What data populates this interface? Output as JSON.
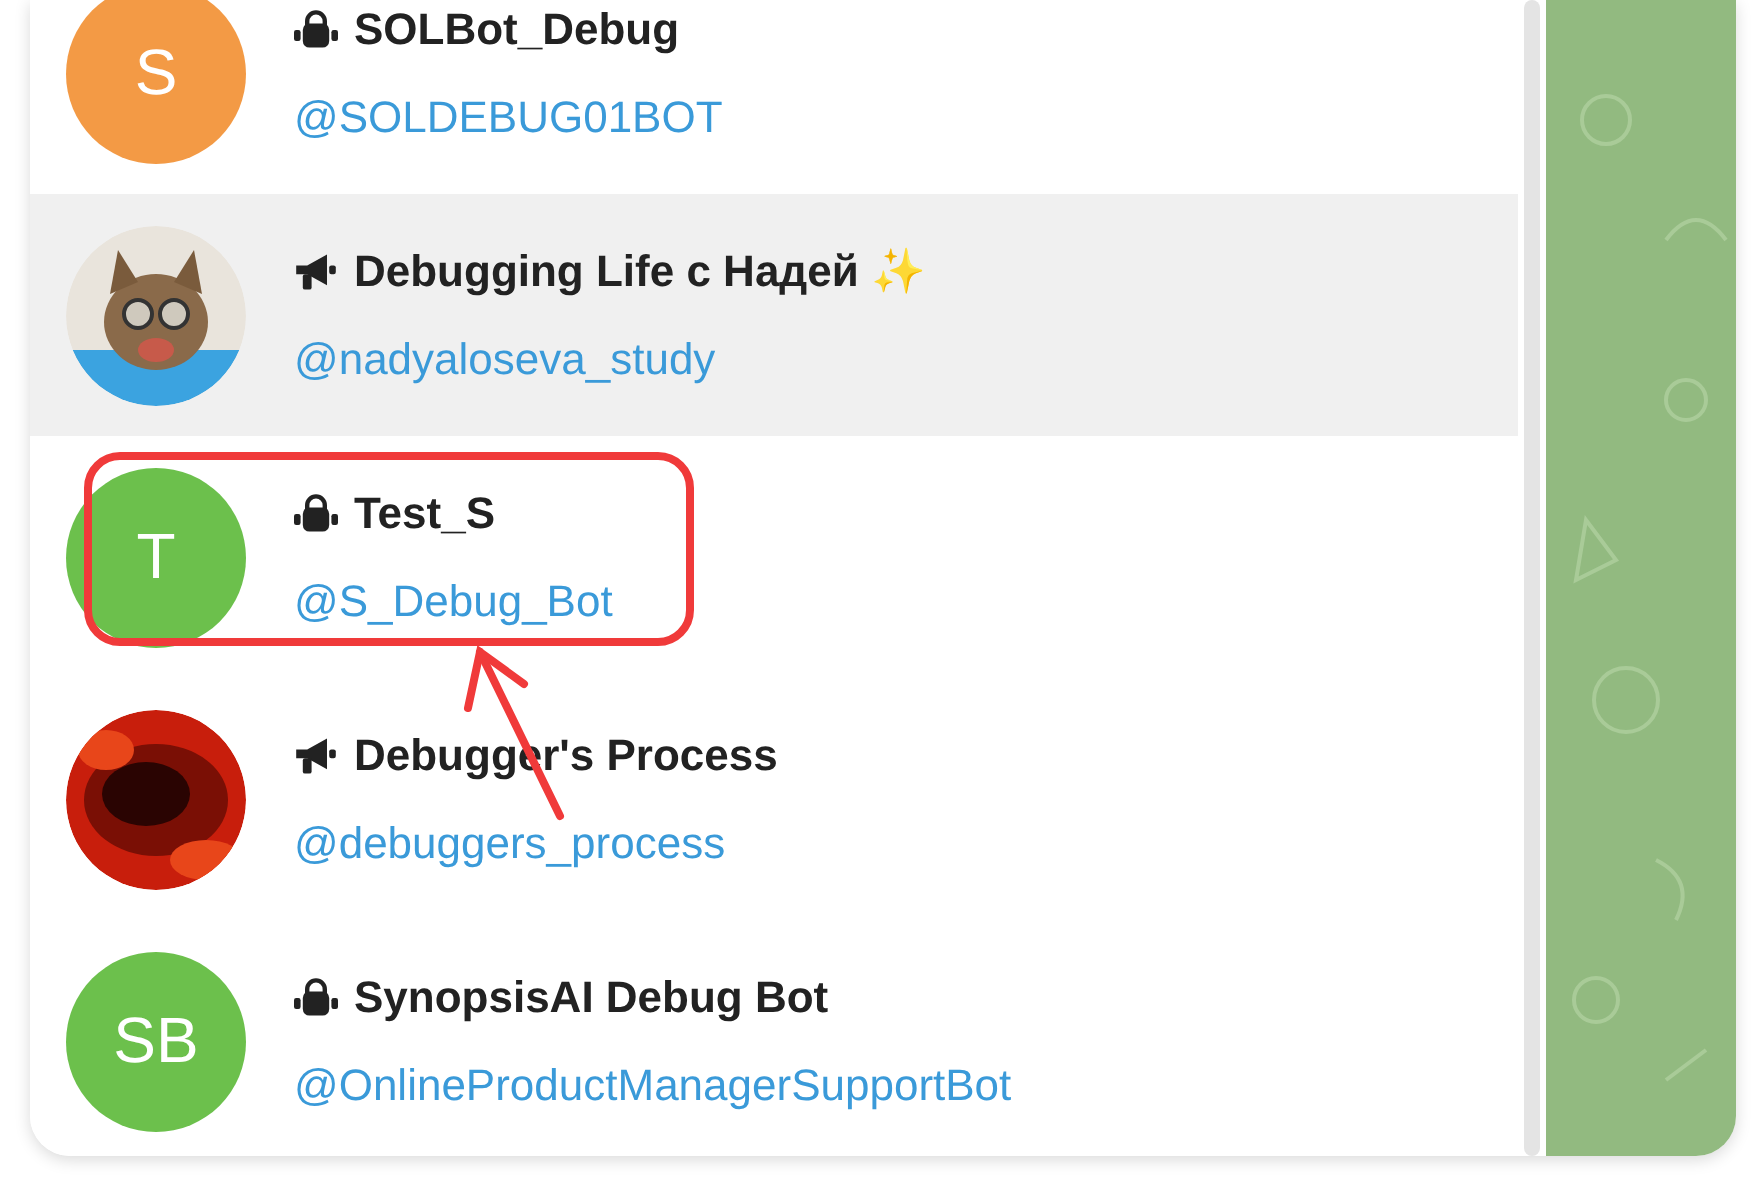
{
  "chats": [
    {
      "kind": "bot",
      "title": "SOLBot_Debug",
      "handle": "@SOLDEBUG01BOT",
      "avatar": {
        "kind": "letter",
        "text": "S",
        "color": "#f39a45"
      },
      "selected": false,
      "annotated": false
    },
    {
      "kind": "channel",
      "title": "Debugging Life с Надей ✨",
      "handle": "@nadyaloseva_study",
      "selected": true,
      "annotated": false
    },
    {
      "kind": "bot",
      "title": "Test_S",
      "handle": "@S_Debug_Bot",
      "avatar": {
        "kind": "letter",
        "text": "T",
        "color": "#6cc04c"
      },
      "selected": false,
      "annotated": true
    },
    {
      "kind": "channel",
      "title": "Debugger's Process",
      "handle": "@debuggers_process",
      "selected": false,
      "annotated": false
    },
    {
      "kind": "bot",
      "title": "SynopsisAI Debug Bot",
      "handle": "@OnlineProductManagerSupportBot",
      "avatar": {
        "kind": "letter",
        "text": "SB",
        "color": "#6cc04c"
      },
      "selected": false,
      "annotated": false
    }
  ]
}
